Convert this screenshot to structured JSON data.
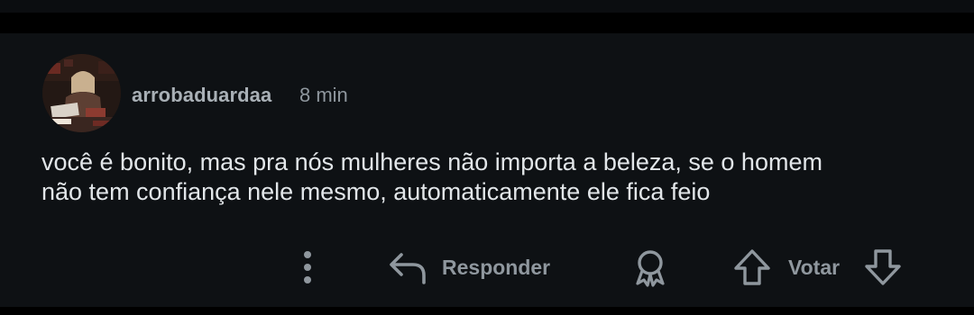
{
  "comment": {
    "username": "arrobaduardaa",
    "timestamp": "8 min",
    "body_lines": [
      "você é bonito, mas pra nós mulheres não importa a beleza, se o homem",
      "não tem confiança nele mesmo, automaticamente ele fica feio"
    ]
  },
  "actions": {
    "more_icon": "vertical-ellipsis-icon",
    "reply_icon": "reply-arrow-icon",
    "reply_label": "Responder",
    "award_icon": "award-icon",
    "upvote_icon": "arrow-up-icon",
    "vote_label": "Votar",
    "downvote_icon": "arrow-down-icon"
  },
  "colors": {
    "background": "#0e1114",
    "text_primary": "#e2e6e9",
    "text_secondary": "#8f979e"
  }
}
